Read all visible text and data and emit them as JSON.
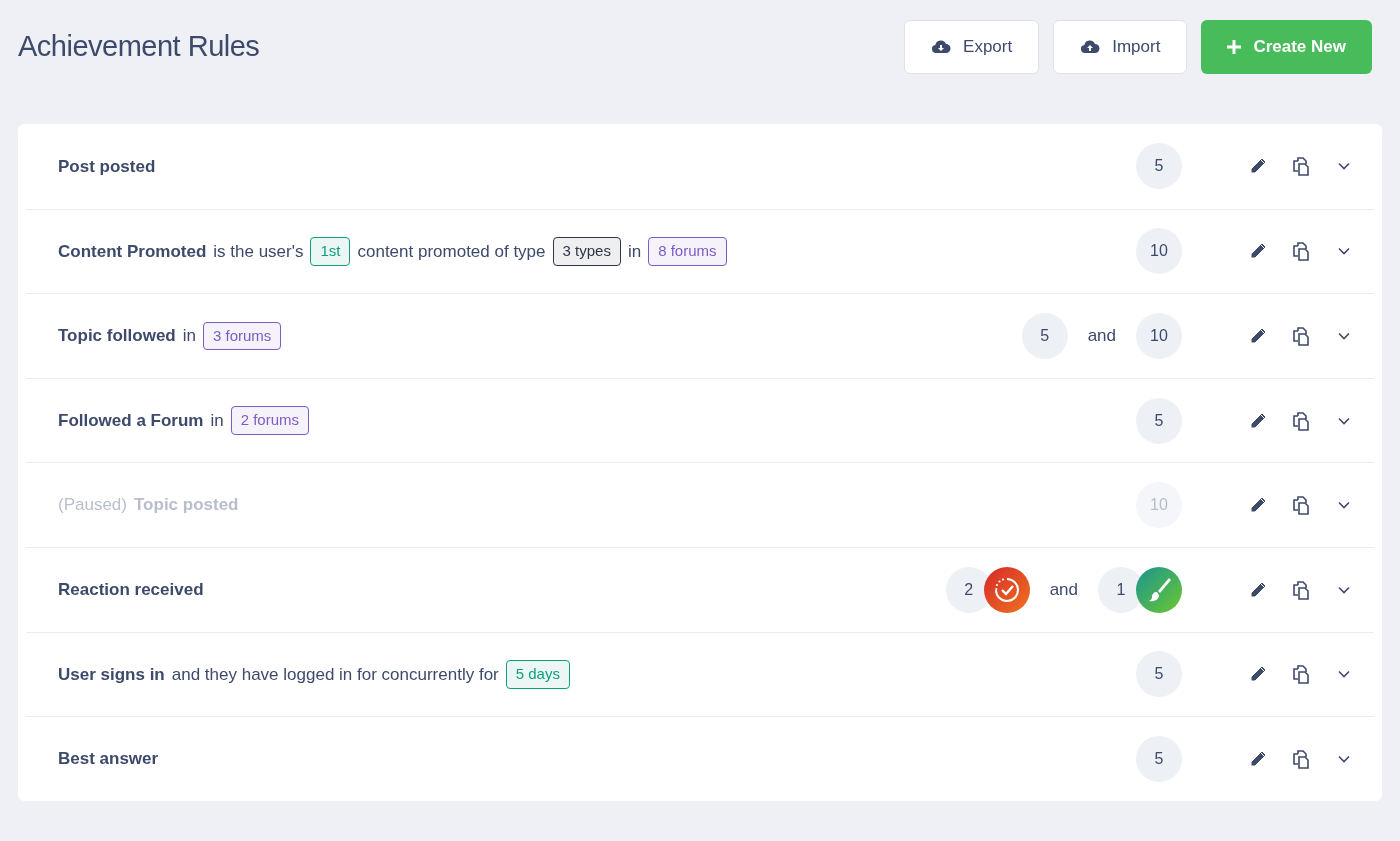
{
  "title": "Achievement Rules",
  "actions": [
    {
      "kind": "export",
      "label": "Export"
    },
    {
      "kind": "import",
      "label": "Import"
    },
    {
      "kind": "create",
      "label": "Create New"
    }
  ],
  "rules": [
    {
      "paused": false,
      "parts": [
        {
          "kind": "bold",
          "text": "Post posted"
        }
      ],
      "rewards": [
        {
          "kind": "points",
          "value": "5"
        }
      ]
    },
    {
      "paused": false,
      "parts": [
        {
          "kind": "bold",
          "text": "Content Promoted"
        },
        {
          "kind": "text",
          "text": "is the user's"
        },
        {
          "kind": "tag",
          "text": "1st",
          "color": "#0f9f7a"
        },
        {
          "kind": "text",
          "text": "content promoted of type"
        },
        {
          "kind": "tag",
          "text": "3 types",
          "color": "#2d3748"
        },
        {
          "kind": "text",
          "text": "in"
        },
        {
          "kind": "tag",
          "text": "8 forums",
          "color": "#7c5cc4"
        }
      ],
      "rewards": [
        {
          "kind": "points",
          "value": "10"
        }
      ]
    },
    {
      "paused": false,
      "parts": [
        {
          "kind": "bold",
          "text": "Topic followed"
        },
        {
          "kind": "text",
          "text": "in"
        },
        {
          "kind": "tag",
          "text": "3 forums",
          "color": "#7c5cc4"
        }
      ],
      "rewards": [
        {
          "kind": "points",
          "value": "5"
        },
        {
          "kind": "joiner",
          "value": "and"
        },
        {
          "kind": "points",
          "value": "10"
        }
      ]
    },
    {
      "paused": false,
      "parts": [
        {
          "kind": "bold",
          "text": "Followed a Forum"
        },
        {
          "kind": "text",
          "text": "in"
        },
        {
          "kind": "tag",
          "text": "2 forums",
          "color": "#7c5cc4"
        }
      ],
      "rewards": [
        {
          "kind": "points",
          "value": "5"
        }
      ]
    },
    {
      "paused": true,
      "parts": [
        {
          "kind": "text",
          "text": "(Paused)"
        },
        {
          "kind": "bold",
          "text": "Topic posted"
        }
      ],
      "rewards": [
        {
          "kind": "points",
          "value": "10"
        }
      ]
    },
    {
      "paused": false,
      "parts": [
        {
          "kind": "bold",
          "text": "Reaction received"
        }
      ],
      "rewards": [
        {
          "kind": "checkbadge",
          "value": "2"
        },
        {
          "kind": "joiner",
          "value": "and"
        },
        {
          "kind": "brushbadge",
          "value": "1"
        }
      ]
    },
    {
      "paused": false,
      "parts": [
        {
          "kind": "bold",
          "text": "User signs in"
        },
        {
          "kind": "text",
          "text": "and they have logged in for concurrently for"
        },
        {
          "kind": "tag",
          "text": "5 days",
          "color": "#0f9f7a"
        }
      ],
      "rewards": [
        {
          "kind": "points",
          "value": "5"
        }
      ]
    },
    {
      "paused": false,
      "parts": [
        {
          "kind": "bold",
          "text": "Best answer"
        }
      ],
      "rewards": [
        {
          "kind": "points",
          "value": "5"
        }
      ]
    }
  ]
}
